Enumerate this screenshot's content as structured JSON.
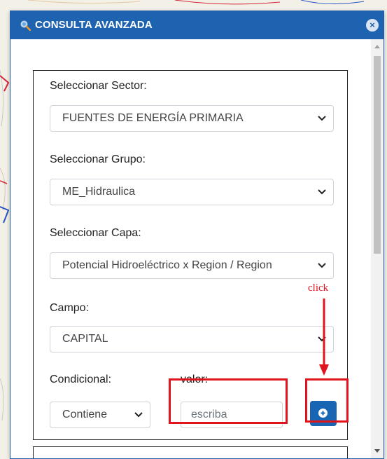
{
  "dialog": {
    "title": "CONSULTA AVANZADA",
    "close_label": "×"
  },
  "form": {
    "sector": {
      "label": "Seleccionar Sector:",
      "value": "FUENTES DE ENERGÍA PRIMARIA"
    },
    "grupo": {
      "label": "Seleccionar Grupo:",
      "value": "ME_Hidraulica"
    },
    "capa": {
      "label": "Seleccionar Capa:",
      "value": "Potencial Hidroeléctrico x Region / Region"
    },
    "campo": {
      "label": "Campo:",
      "value": "CAPITAL"
    },
    "condicional": {
      "label": "Condicional:",
      "value": "Contiene"
    },
    "valor": {
      "label": "valor:",
      "placeholder": "escriba"
    }
  },
  "annotation": {
    "text": "click"
  },
  "colors": {
    "titlebar": "#1e63b0",
    "button": "#1765b3",
    "highlight": "#e0141f"
  },
  "icons": {
    "title": "search-icon",
    "close": "close-icon",
    "add": "plus-circle-icon",
    "dropdown": "chevron-down-icon"
  }
}
